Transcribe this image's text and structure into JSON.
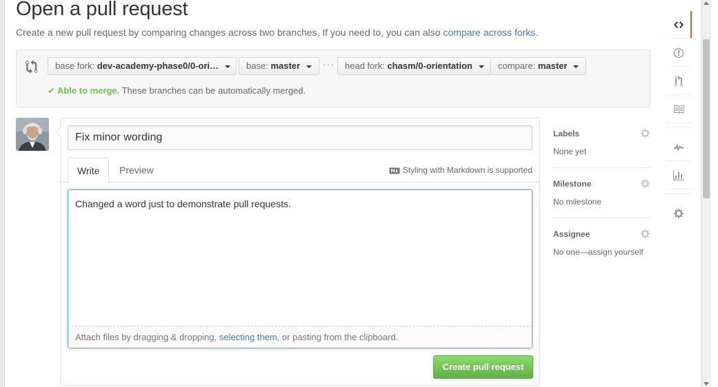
{
  "page": {
    "title": "Open a pull request",
    "description": "Create a new pull request by comparing changes across two branches. If you need to, you can also",
    "description_link": "compare across forks."
  },
  "range": {
    "base_fork_label": "base fork:",
    "base_fork_value": "dev-academy-phase0/0-ori…",
    "base_label": "base:",
    "base_value": "master",
    "ellipsis": "···",
    "head_fork_label": "head fork:",
    "head_fork_value": "chasm/0-orientation",
    "compare_label": "compare:",
    "compare_value": "master",
    "merge_ok": "Able to merge.",
    "merge_text": "These branches can be automatically merged."
  },
  "form": {
    "title_value": "Fix minor wording",
    "tabs": [
      {
        "label": "Write"
      },
      {
        "label": "Preview"
      }
    ],
    "markdown_hint": "Styling with Markdown is supported",
    "body_value": "Changed a word just to demonstrate pull requests.",
    "attach_prefix": "Attach files by dragging & dropping,",
    "attach_link": "selecting them",
    "attach_suffix": ", or pasting from the clipboard.",
    "submit_label": "Create pull request"
  },
  "sidebar": {
    "labels": {
      "heading": "Labels",
      "value": "None yet"
    },
    "milestone": {
      "heading": "Milestone",
      "value": "No milestone"
    },
    "assignee": {
      "heading": "Assignee",
      "value": "No one—assign yourself"
    }
  },
  "repo_nav": {
    "items": [
      "code-icon",
      "issues-icon",
      "pull-requests-icon",
      "wiki-icon",
      "pulse-icon",
      "graphs-icon",
      "settings-icon"
    ]
  },
  "colors": {
    "link": "#4078c0",
    "success": "#6cc644",
    "button_green": "#60b044",
    "focus_blue": "#51a7e8",
    "nav_selected": "#d26911"
  }
}
